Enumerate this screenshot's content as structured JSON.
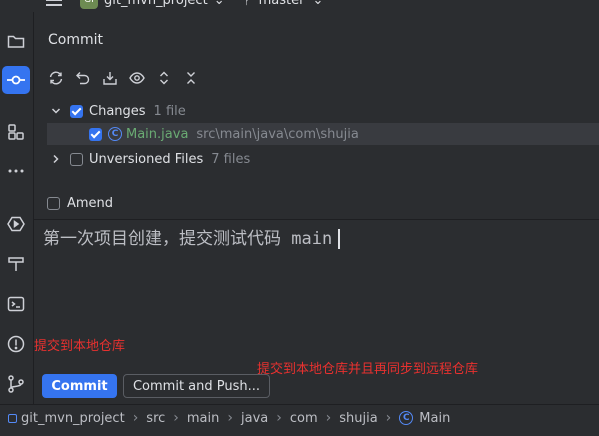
{
  "topbar": {
    "project_badge": "GI",
    "project_name": "git_mvn_project",
    "project_chevron": "⌄",
    "branch_icon": "branch-icon",
    "branch_name": "master",
    "branch_chevron": "⌄"
  },
  "toolstrip": {
    "items": [
      "folder-icon",
      "commit-icon",
      "structure-icon",
      "more-icon",
      "services-icon",
      "build-icon",
      "terminal-icon",
      "problems-icon",
      "git-icon"
    ]
  },
  "commit_panel": {
    "title": "Commit",
    "toolbar": [
      "refresh-icon",
      "rollback-icon",
      "shelve-icon",
      "preview-icon",
      "expand-icon",
      "collapse-icon"
    ],
    "changes": {
      "label": "Changes",
      "count": "1 file",
      "files": [
        {
          "name": "Main.java",
          "path": "src\\main\\java\\com\\shujia",
          "checked": true
        }
      ]
    },
    "unversioned": {
      "label": "Unversioned Files",
      "count": "7 files"
    },
    "amend_label": "Amend",
    "message": "第一次项目创建，提交测试代码 main",
    "commit_button": "Commit",
    "commit_push_button": "Commit and Push..."
  },
  "annotations": {
    "local_commit": "提交到本地仓库",
    "commit_and_push": "提交到本地仓库并且再同步到远程仓库"
  },
  "breadcrumbs": [
    "git_mvn_project",
    "src",
    "main",
    "java",
    "com",
    "shujia",
    "Main"
  ],
  "colors": {
    "background": "#2b2d30",
    "accent": "#3574f0",
    "annotation": "#e8312f",
    "file_modified": "#6aab73"
  }
}
